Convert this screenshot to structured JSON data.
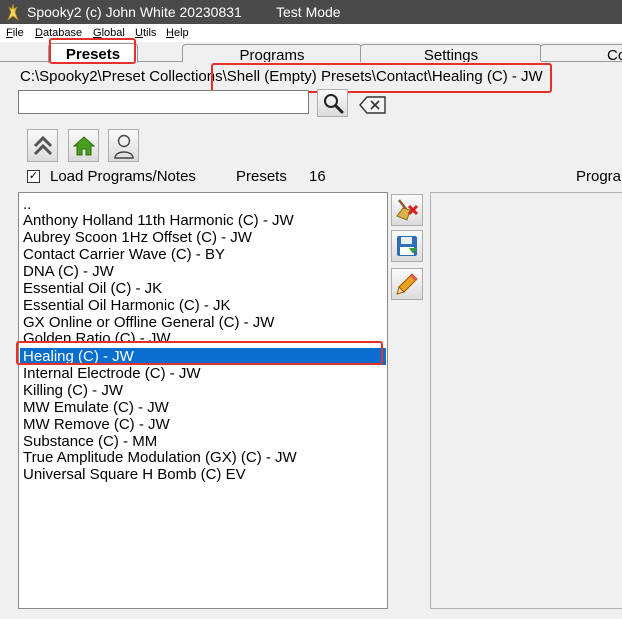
{
  "window": {
    "title": "Spooky2 (c) John White 20230831",
    "mode": "Test Mode"
  },
  "menu": [
    {
      "label": "ile",
      "accel": "F"
    },
    {
      "label": "atabase",
      "accel": "D"
    },
    {
      "label": "lobal",
      "accel": "G"
    },
    {
      "label": "tils",
      "accel": "U"
    },
    {
      "label": "elp",
      "accel": "H"
    }
  ],
  "tabs": {
    "presets": "Presets",
    "programs": "Programs",
    "settings": "Settings",
    "next": "Co"
  },
  "path": "C:\\Spooky2\\Preset Collections\\Shell (Empty) Presets\\Contact\\Healing (C) - JW",
  "search": {
    "value": ""
  },
  "toolbar": {
    "up_icon": "double-chevron-up-icon",
    "home_icon": "home-icon",
    "user_icon": "user-icon"
  },
  "load_programs": {
    "label": "Load Programs/Notes",
    "checked": true,
    "mark": "✓"
  },
  "presets_count": {
    "label": "Presets",
    "count": "16"
  },
  "right_header": "Progra",
  "presets_list": {
    "items": [
      "..",
      "Anthony Holland 11th Harmonic (C) - JW",
      "Aubrey Scoon 1Hz Offset (C) - JW",
      "Contact Carrier Wave (C) - BY",
      "DNA (C) - JW",
      "Essential Oil (C) - JK",
      "Essential Oil Harmonic (C) - JK",
      "GX Online or Offline General (C) - JW",
      "Golden Ratio (C) - JW",
      "Healing (C) - JW",
      "Internal Electrode (C) - JW",
      "Killing (C) - JW",
      "MW Emulate (C) - JW",
      "MW Remove (C) - JW",
      "Substance (C) - MM",
      "True Amplitude Modulation (GX) (C) - JW",
      "Universal Square H Bomb (C) EV"
    ],
    "selected_index": 9
  },
  "side_buttons": [
    "broom-delete-icon",
    "save-icon",
    "pencil-edit-icon"
  ],
  "colors": {
    "selection": "#0a6ed1",
    "highlight": "#e8302a",
    "titlebar": "#4a4a4a"
  }
}
